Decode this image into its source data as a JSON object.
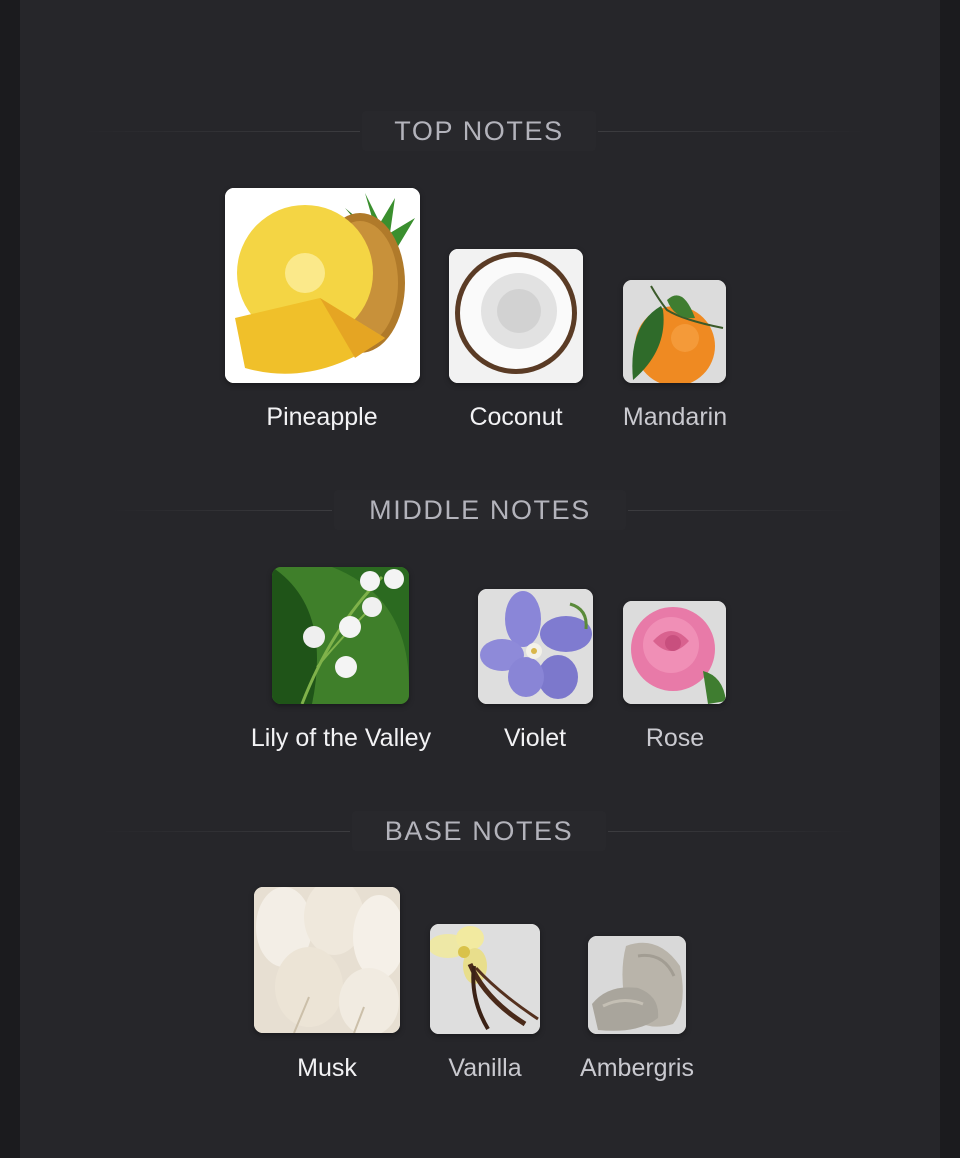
{
  "sections": [
    {
      "title": "TOP NOTES",
      "notes": [
        {
          "name": "Pineapple",
          "icon": "pineapple-icon"
        },
        {
          "name": "Coconut",
          "icon": "coconut-icon"
        },
        {
          "name": "Mandarin",
          "icon": "mandarin-icon"
        }
      ]
    },
    {
      "title": "MIDDLE NOTES",
      "notes": [
        {
          "name": "Lily of the Valley",
          "icon": "lily-of-the-valley-icon"
        },
        {
          "name": "Violet",
          "icon": "violet-icon"
        },
        {
          "name": "Rose",
          "icon": "rose-icon"
        }
      ]
    },
    {
      "title": "BASE NOTES",
      "notes": [
        {
          "name": "Musk",
          "icon": "musk-icon"
        },
        {
          "name": "Vanilla",
          "icon": "vanilla-icon"
        },
        {
          "name": "Ambergris",
          "icon": "ambergris-icon"
        }
      ]
    }
  ],
  "colors": {
    "background": "#26262a",
    "header_text": "#b3b3bb",
    "label_primary": "#f2f2f4",
    "label_secondary": "#c9c9cf"
  }
}
